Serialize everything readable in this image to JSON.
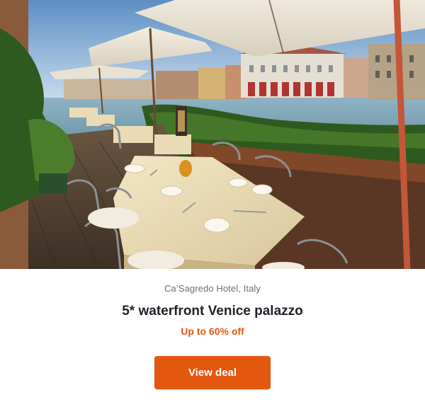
{
  "hero": {
    "image_subject": "waterfront-restaurant-terrace-photo"
  },
  "listing": {
    "location": "Ca’Sagredo Hotel, Italy",
    "title": "5* waterfront Venice palazzo",
    "offer": "Up to 60% off"
  },
  "cta": {
    "label": "View deal"
  },
  "colors": {
    "accent": "#e4570f",
    "offer_text": "#e4570f",
    "title_text": "#1f2328",
    "location_text": "#6b6f75"
  }
}
